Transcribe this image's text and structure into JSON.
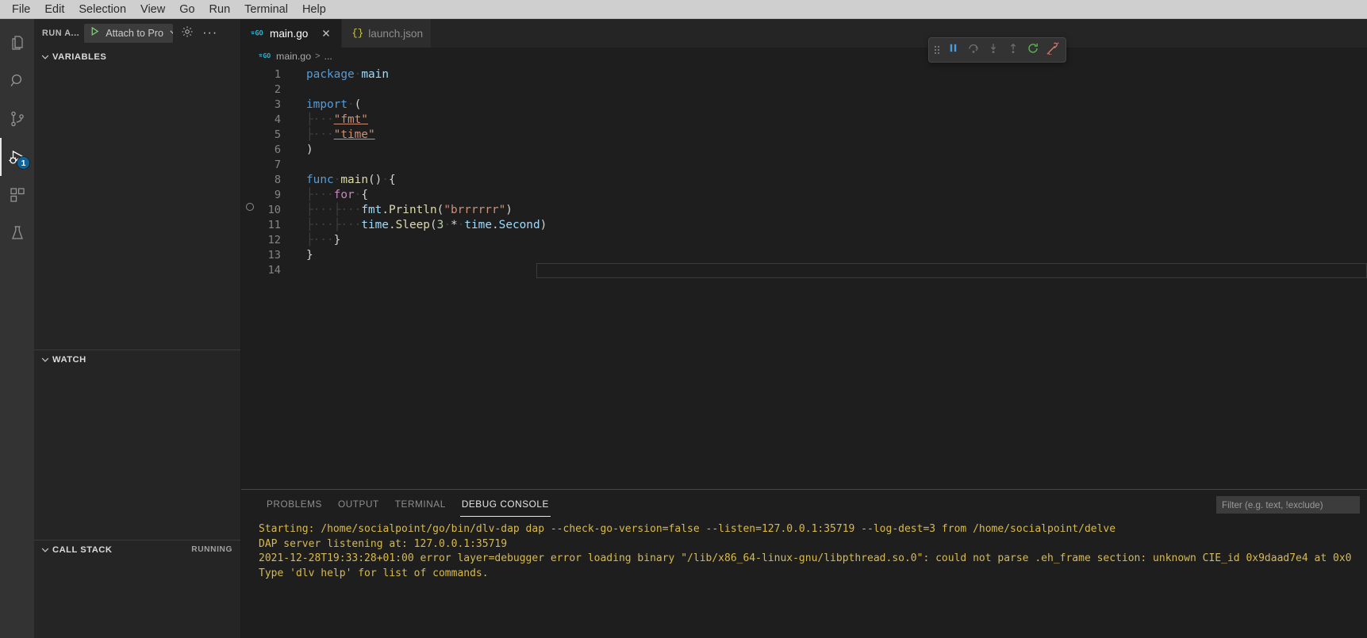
{
  "window": {
    "menu": [
      "File",
      "Edit",
      "Selection",
      "View",
      "Go",
      "Run",
      "Terminal",
      "Help"
    ]
  },
  "activitybar": {
    "items": [
      {
        "name": "explorer",
        "icon": "files-icon",
        "badge": ""
      },
      {
        "name": "search",
        "icon": "search-icon",
        "badge": ""
      },
      {
        "name": "source-control",
        "icon": "source-control-icon",
        "badge": ""
      },
      {
        "name": "run-and-debug",
        "icon": "run-and-debug-icon",
        "badge": "1"
      },
      {
        "name": "extensions",
        "icon": "extensions-icon",
        "badge": ""
      },
      {
        "name": "testing",
        "icon": "beaker-icon",
        "badge": ""
      }
    ],
    "active": "run-and-debug"
  },
  "sidebar": {
    "title": "RUN A...",
    "launch_config": "Attach to Pro",
    "start_icon": "play-icon",
    "settings_icon": "gear-icon",
    "more_icon": "ellipsis-icon",
    "panes": [
      {
        "title": "VARIABLES",
        "status": "",
        "expanded": true
      },
      {
        "title": "WATCH",
        "status": "",
        "expanded": true
      },
      {
        "title": "CALL STACK",
        "status": "RUNNING",
        "expanded": true
      }
    ]
  },
  "editor": {
    "tabs": [
      {
        "label": "main.go",
        "icon": "go-file-icon",
        "active": true,
        "closable": true
      },
      {
        "label": "launch.json",
        "icon": "json-file-icon",
        "active": false,
        "closable": false
      }
    ],
    "breadcrumb": {
      "icon": "go-file-icon",
      "file": "main.go",
      "separator": ">",
      "overflow": "..."
    },
    "close_icon": "close-icon",
    "language": "go",
    "breakpoint_line": 10,
    "cursor_line": 14,
    "lines": [
      {
        "n": 1,
        "text": "package main"
      },
      {
        "n": 2,
        "text": ""
      },
      {
        "n": 3,
        "text": "import ("
      },
      {
        "n": 4,
        "text": "    \"fmt\""
      },
      {
        "n": 5,
        "text": "    \"time\""
      },
      {
        "n": 6,
        "text": ")"
      },
      {
        "n": 7,
        "text": ""
      },
      {
        "n": 8,
        "text": "func main() {"
      },
      {
        "n": 9,
        "text": "    for {"
      },
      {
        "n": 10,
        "text": "        fmt.Println(\"brrrrrr\")"
      },
      {
        "n": 11,
        "text": "        time.Sleep(3 * time.Second)"
      },
      {
        "n": 12,
        "text": "    }"
      },
      {
        "n": 13,
        "text": "}"
      },
      {
        "n": 14,
        "text": ""
      }
    ]
  },
  "debug_toolbar": {
    "grip_icon": "drag-handle-icon",
    "buttons": [
      {
        "name": "pause-button",
        "icon": "pause-icon",
        "enabled": true,
        "color": "#4a9ae0"
      },
      {
        "name": "step-over-button",
        "icon": "step-over-icon",
        "enabled": false,
        "color": "#6e6e6e"
      },
      {
        "name": "step-into-button",
        "icon": "step-into-icon",
        "enabled": false,
        "color": "#6e6e6e"
      },
      {
        "name": "step-out-button",
        "icon": "step-out-icon",
        "enabled": false,
        "color": "#6e6e6e"
      },
      {
        "name": "restart-button",
        "icon": "restart-icon",
        "enabled": true,
        "color": "#5ab552"
      },
      {
        "name": "disconnect-button",
        "icon": "disconnect-icon",
        "enabled": true,
        "color": "#d17a6e"
      }
    ]
  },
  "panel": {
    "tabs": [
      "PROBLEMS",
      "OUTPUT",
      "TERMINAL",
      "DEBUG CONSOLE"
    ],
    "active_tab": "DEBUG CONSOLE",
    "filter_placeholder": "Filter (e.g. text, !exclude)",
    "console_lines": [
      "Starting: /home/socialpoint/go/bin/dlv-dap dap --check-go-version=false --listen=127.0.0.1:35719 --log-dest=3 from /home/socialpoint/delve",
      "DAP server listening at: 127.0.0.1:35719",
      "2021-12-28T19:33:28+01:00 error layer=debugger error loading binary \"/lib/x86_64-linux-gnu/libpthread.so.0\": could not parse .eh_frame section: unknown CIE_id 0x9daad7e4 at 0x0",
      "Type 'dlv help' for list of commands."
    ]
  },
  "colors": {
    "accent": "#0e639c",
    "console_text": "#d7ba4f",
    "running_badge": "#a0a0a0",
    "pause": "#4a9ae0",
    "restart": "#5ab552",
    "disconnect": "#d17a6e"
  }
}
